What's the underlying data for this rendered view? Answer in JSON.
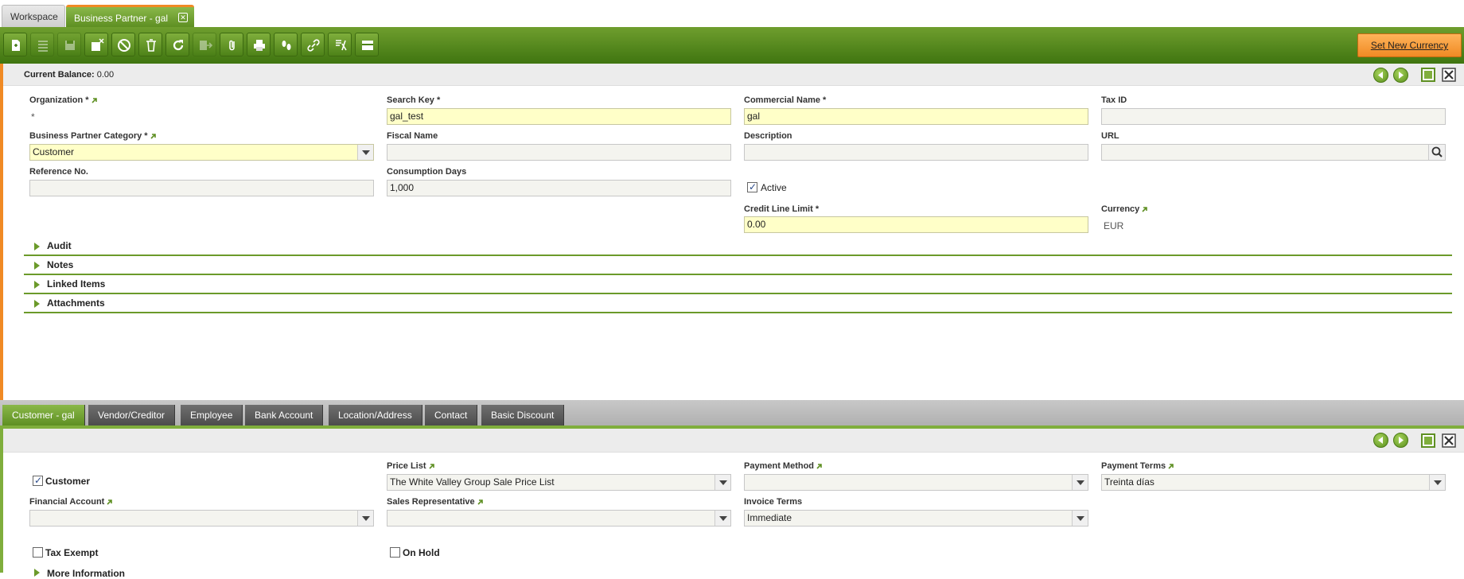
{
  "tabs": {
    "workspace": "Workspace",
    "business_partner": "Business Partner - gal"
  },
  "toolbar": {
    "set_new_currency": "Set New Currency",
    "buttons": [
      "new-doc",
      "grid-view",
      "save",
      "save-close",
      "undo",
      "delete",
      "refresh",
      "export",
      "attach",
      "print",
      "audit-trail",
      "link",
      "tools",
      "layout"
    ]
  },
  "status": {
    "label": "Current Balance:",
    "value": "0.00"
  },
  "form": {
    "organization": {
      "label": "Organization *",
      "value": "*"
    },
    "search_key": {
      "label": "Search Key *",
      "value": "gal_test"
    },
    "commercial_name": {
      "label": "Commercial Name *",
      "value": "gal"
    },
    "tax_id": {
      "label": "Tax ID",
      "value": ""
    },
    "bp_category": {
      "label": "Business Partner Category *",
      "value": "Customer"
    },
    "fiscal_name": {
      "label": "Fiscal Name",
      "value": ""
    },
    "description": {
      "label": "Description",
      "value": ""
    },
    "url": {
      "label": "URL",
      "value": ""
    },
    "reference_no": {
      "label": "Reference No.",
      "value": ""
    },
    "consumption_days": {
      "label": "Consumption Days",
      "value": "1,000"
    },
    "active": {
      "label": "Active",
      "checked": true
    },
    "credit_line_limit": {
      "label": "Credit Line Limit *",
      "value": "0.00"
    },
    "currency": {
      "label": "Currency",
      "value": "EUR"
    }
  },
  "sections": [
    "Audit",
    "Notes",
    "Linked Items",
    "Attachments"
  ],
  "child_tabs": [
    "Customer - gal",
    "Vendor/Creditor",
    "Employee",
    "Bank Account",
    "Location/Address",
    "Contact",
    "Basic Discount"
  ],
  "customer": {
    "customer": {
      "label": "Customer",
      "checked": true
    },
    "price_list": {
      "label": "Price List",
      "value": "The White Valley Group Sale Price List"
    },
    "payment_method": {
      "label": "Payment Method",
      "value": ""
    },
    "payment_terms": {
      "label": "Payment Terms",
      "value": "Treinta días"
    },
    "financial_account": {
      "label": "Financial Account",
      "value": ""
    },
    "sales_rep": {
      "label": "Sales Representative",
      "value": ""
    },
    "invoice_terms": {
      "label": "Invoice Terms",
      "value": "Immediate"
    },
    "tax_exempt": {
      "label": "Tax Exempt",
      "checked": false
    },
    "on_hold": {
      "label": "On Hold",
      "checked": false
    },
    "more_info": "More Information"
  },
  "colors": {
    "green_accent": "#5e8f22",
    "orange_accent": "#f08a24",
    "required_bg": "#ffffc8"
  }
}
